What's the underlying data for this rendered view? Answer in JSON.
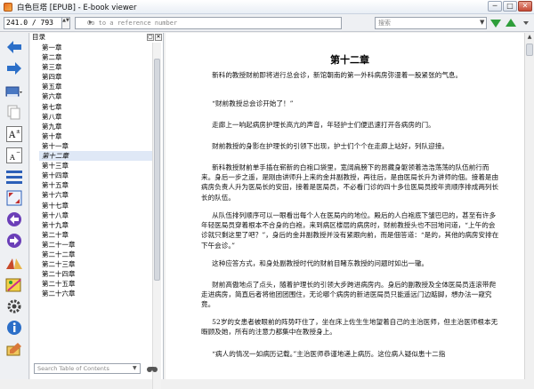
{
  "window": {
    "title": "白色巨塔 [EPUB] - E-book viewer",
    "min_label": "─",
    "max_label": "□",
    "close_label": "✕"
  },
  "toolbar": {
    "position_value": "241.0 / 793",
    "spin_label": "▲▼",
    "goto_placeholder": "Go to a reference number",
    "goto_arrow": "▸",
    "search_placeholder": "搜索",
    "search_dropdown": "▼"
  },
  "left_toolbar_icons": [
    "back-arrow-icon",
    "forward-arrow-icon",
    "library-icon",
    "copy-icon",
    "font-larger-icon",
    "font-smaller-icon",
    "toc-icon",
    "fullscreen-icon",
    "previous-icon",
    "next-icon",
    "bookmark-icon",
    "reference-mode-icon",
    "preferences-icon",
    "info-icon",
    "inspector-icon"
  ],
  "colors": {
    "accent_blue": "#2c6fc8",
    "green_arrow": "#2e9e3a",
    "toc_selected_bg": "#dfe8f6"
  },
  "toc": {
    "header": "目录",
    "close_label": "✕",
    "float_label": "▢",
    "selected_index": 11,
    "items": [
      "第一章",
      "第二章",
      "第三章",
      "第四章",
      "第五章",
      "第六章",
      "第七章",
      "第八章",
      "第九章",
      "第十章",
      "第十一章",
      "第十二章",
      "第十三章",
      "第十四章",
      "第十五章",
      "第十六章",
      "第十七章",
      "第十八章",
      "第十九章",
      "第二十章",
      "第二十一章",
      "第二十二章",
      "第二十三章",
      "第二十四章",
      "第二十五章",
      "第二十六章"
    ],
    "search_placeholder": "Search Table of Contents",
    "search_dropdown": "▼"
  },
  "reader": {
    "chapter_title": "第十二章",
    "paragraphs": [
      "新科的教授财前即将进行总会诊，新馆朝南的第一外科病房弥漫着一股紧张的气息。",
      "“财前教授总会诊开始了！”",
      "走廊上一响起病房护理长高亢的声音，年轻护士们便迅速打开各病房的门。",
      "财前教授的身影在护理长的引领下出现，护士们个个在走廊上站好，列队迎接。",
      "新科教授财前单手插在崭新的白袍口袋里，宽阔肩膀下的昂藏身躯领着浩浩荡荡的队伍前行而来。身后一步之遥，是刚由讲师升上来的金井副教授，再往后，是由医局长升为讲师的佃。接着是由病房负责人升为医局长的安田，接着是医局员，不必看门诊的四十多位医局员按年资顺序排成两列长长的队伍。",
      "从队伍排列顺序可以一眼看出每个人在医局内的地位。殿后的人白袍底下皱巴巴的，甚至有许多年轻医局员穿着根本不合身的白袍，来到病区楼层的病房时，财前教授头也不回地问道，“上午的会诊就只剩这里了吧？”，身后的金井副教授并没有紧跟向前，而是佃答道：“是的，其他的病房安排在下午会诊。”",
      "这种应答方式，和身处副教授时代的财前目睹东教授的问题时如出一辙。",
      "财前高傲地点了点头，随着护理长的引领大步跨进病房内。身后的副教授及全体医局员连滚带爬走进病房，简直后者将他团团围住，无论哪个病房的新进医局员只能遥远门边踮脚，想办法一窥究竟。",
      "52岁的女患者被眼前的阵势吓住了，坐在床上佐生生地望着自己的主治医师，但主治医师根本无暇顾及她，所有的注意力都集中在教授身上。",
      "“病人的情况一如病历记载。”主治医师恭谨地递上病历。这位病人疑似患十二指"
    ]
  }
}
